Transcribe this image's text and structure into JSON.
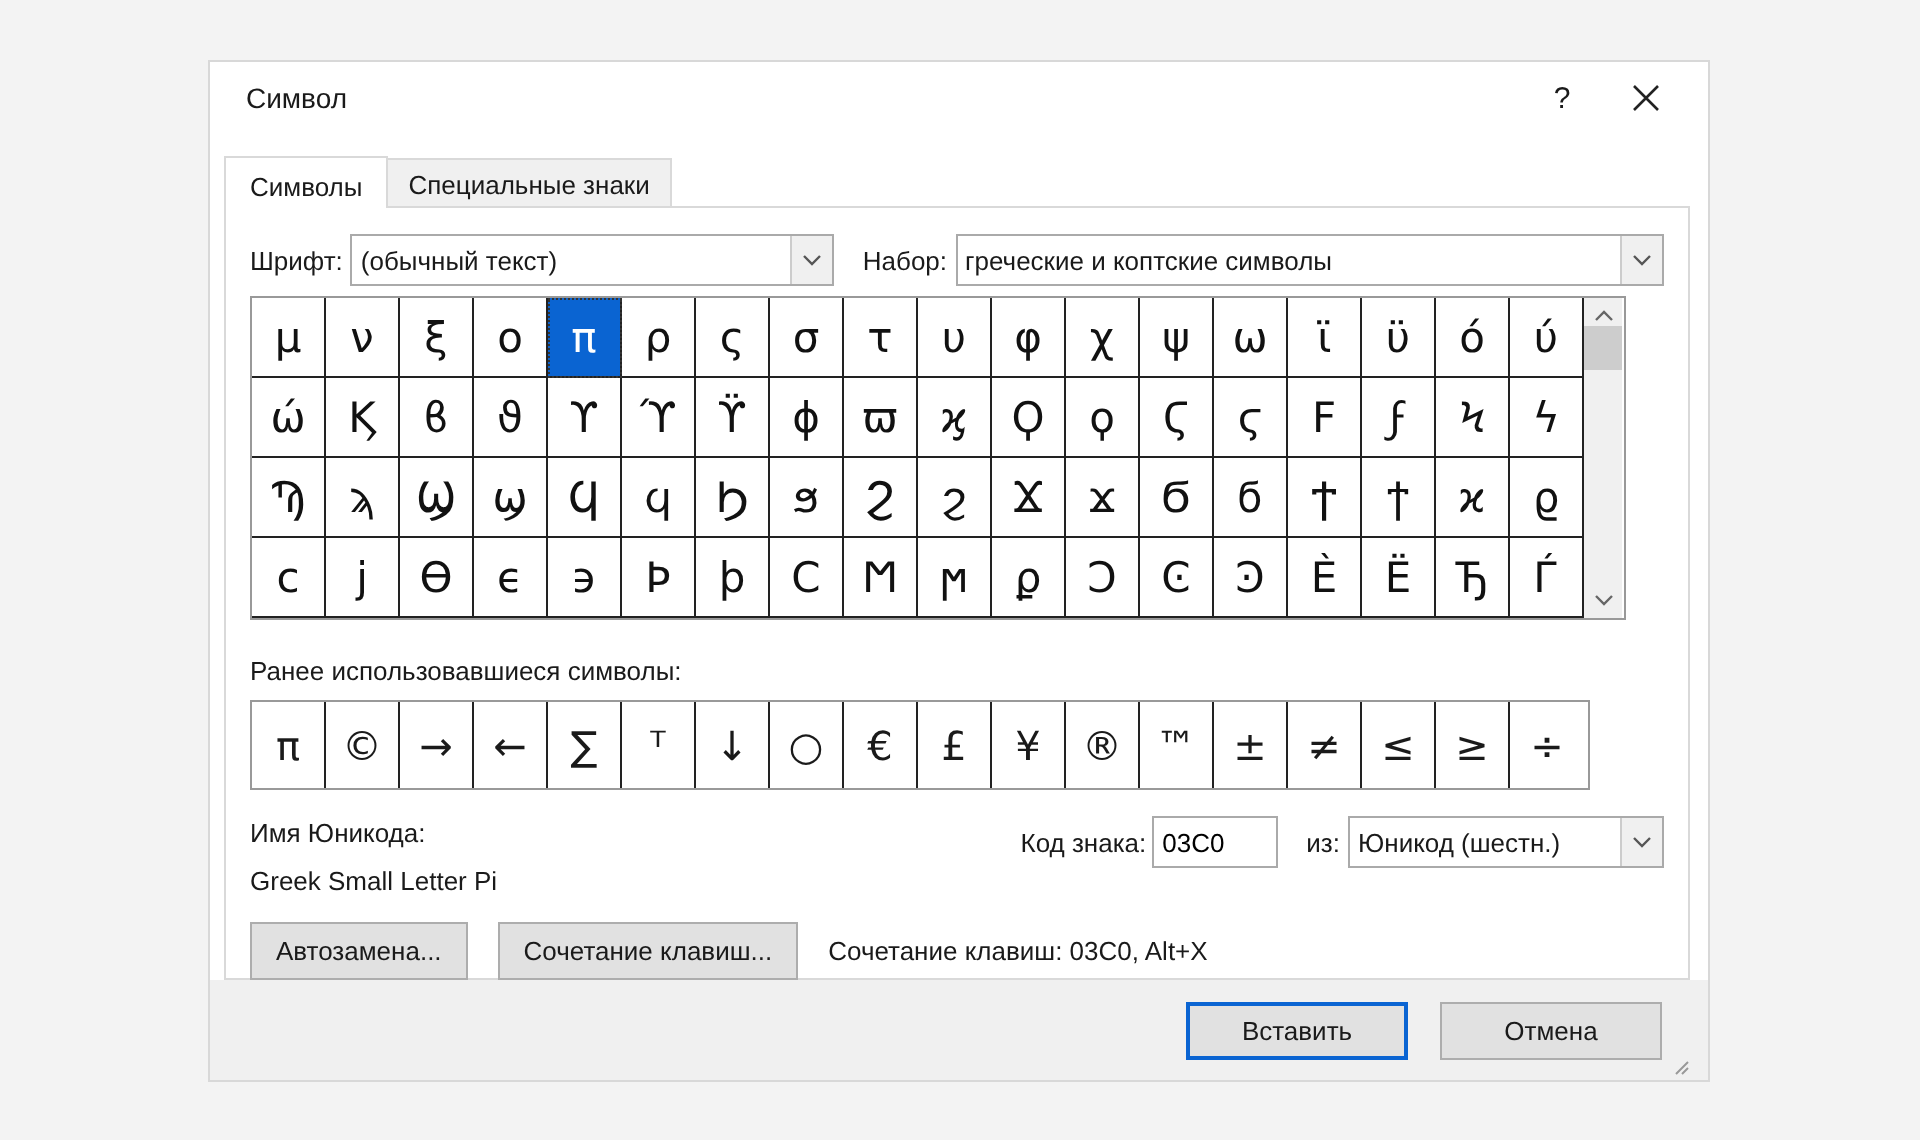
{
  "window": {
    "title": "Символ",
    "help": "?"
  },
  "tabs": [
    {
      "label": "Символы",
      "selected": true
    },
    {
      "label": "Специальные знаки",
      "selected": false
    }
  ],
  "font_field": {
    "label": "Шрифт:",
    "value": "(обычный текст)"
  },
  "subset_field": {
    "label": "Набор:",
    "value": "греческие и коптские символы"
  },
  "symbol_grid": {
    "rows": [
      [
        {
          "char": "μ",
          "selected": false
        },
        {
          "char": "ν",
          "selected": false
        },
        {
          "char": "ξ",
          "selected": false
        },
        {
          "char": "ο",
          "selected": false
        },
        {
          "char": "π",
          "selected": true
        },
        {
          "char": "ρ",
          "selected": false
        },
        {
          "char": "ς",
          "selected": false
        },
        {
          "char": "σ",
          "selected": false
        },
        {
          "char": "τ",
          "selected": false
        },
        {
          "char": "υ",
          "selected": false
        },
        {
          "char": "φ",
          "selected": false
        },
        {
          "char": "χ",
          "selected": false
        },
        {
          "char": "ψ",
          "selected": false
        },
        {
          "char": "ω",
          "selected": false
        },
        {
          "char": "ϊ",
          "selected": false
        },
        {
          "char": "ϋ",
          "selected": false
        },
        {
          "char": "ό",
          "selected": false
        },
        {
          "char": "ύ",
          "selected": false
        }
      ],
      [
        {
          "char": "ώ",
          "selected": false
        },
        {
          "char": "Ϗ",
          "selected": false
        },
        {
          "char": "ϐ",
          "selected": false
        },
        {
          "char": "ϑ",
          "selected": false
        },
        {
          "char": "ϒ",
          "selected": false
        },
        {
          "char": "ϓ",
          "selected": false
        },
        {
          "char": "ϔ",
          "selected": false
        },
        {
          "char": "ϕ",
          "selected": false
        },
        {
          "char": "ϖ",
          "selected": false
        },
        {
          "char": "ϗ",
          "selected": false
        },
        {
          "char": "Ϙ",
          "selected": false
        },
        {
          "char": "ϙ",
          "selected": false
        },
        {
          "char": "Ϛ",
          "selected": false
        },
        {
          "char": "ϛ",
          "selected": false
        },
        {
          "char": "Ϝ",
          "selected": false
        },
        {
          "char": "ϝ",
          "selected": false
        },
        {
          "char": "Ϟ",
          "selected": false
        },
        {
          "char": "ϟ",
          "selected": false
        }
      ],
      [
        {
          "char": "Ϡ",
          "selected": false
        },
        {
          "char": "ϡ",
          "selected": false
        },
        {
          "char": "Ϣ",
          "selected": false
        },
        {
          "char": "ϣ",
          "selected": false
        },
        {
          "char": "Ϥ",
          "selected": false
        },
        {
          "char": "ϥ",
          "selected": false
        },
        {
          "char": "Ϧ",
          "selected": false
        },
        {
          "char": "ϧ",
          "selected": false
        },
        {
          "char": "Ϩ",
          "selected": false
        },
        {
          "char": "ϩ",
          "selected": false
        },
        {
          "char": "Ϫ",
          "selected": false
        },
        {
          "char": "ϫ",
          "selected": false
        },
        {
          "char": "Ϭ",
          "selected": false
        },
        {
          "char": "ϭ",
          "selected": false
        },
        {
          "char": "Ϯ",
          "selected": false
        },
        {
          "char": "ϯ",
          "selected": false
        },
        {
          "char": "ϰ",
          "selected": false
        },
        {
          "char": "ϱ",
          "selected": false
        }
      ],
      [
        {
          "char": "ϲ",
          "selected": false
        },
        {
          "char": "ϳ",
          "selected": false
        },
        {
          "char": "ϴ",
          "selected": false
        },
        {
          "char": "ϵ",
          "selected": false
        },
        {
          "char": "϶",
          "selected": false
        },
        {
          "char": "Ϸ",
          "selected": false
        },
        {
          "char": "ϸ",
          "selected": false
        },
        {
          "char": "Ϲ",
          "selected": false
        },
        {
          "char": "Ϻ",
          "selected": false
        },
        {
          "char": "ϻ",
          "selected": false
        },
        {
          "char": "ϼ",
          "selected": false
        },
        {
          "char": "Ͻ",
          "selected": false
        },
        {
          "char": "Ͼ",
          "selected": false
        },
        {
          "char": "Ͽ",
          "selected": false
        },
        {
          "char": "Ѐ",
          "selected": false
        },
        {
          "char": "Ё",
          "selected": false
        },
        {
          "char": "Ђ",
          "selected": false
        },
        {
          "char": "Ѓ",
          "selected": false
        }
      ]
    ]
  },
  "recent": {
    "label": "Ранее использовавшиеся символы:",
    "symbols": [
      "π",
      "©",
      "→",
      "←",
      "∑",
      "ᵀ",
      "↓",
      "○",
      "€",
      "£",
      "¥",
      "®",
      "™",
      "±",
      "≠",
      "≤",
      "≥",
      "÷"
    ]
  },
  "unicode_name": {
    "label": "Имя Юникода:",
    "value": "Greek Small Letter Pi"
  },
  "char_code": {
    "label": "Код знака:",
    "value": "03C0"
  },
  "from_field": {
    "label": "из:",
    "value": "Юникод (шестн.)"
  },
  "buttons": [
    {
      "label": "Автозамена..."
    },
    {
      "label": "Сочетание клавиш..."
    }
  ],
  "shortcut_text": "Сочетание клавиш: 03C0, Alt+X",
  "footer_buttons": [
    {
      "label": "Вставить",
      "default": true
    },
    {
      "label": "Отмена",
      "default": false
    }
  ]
}
